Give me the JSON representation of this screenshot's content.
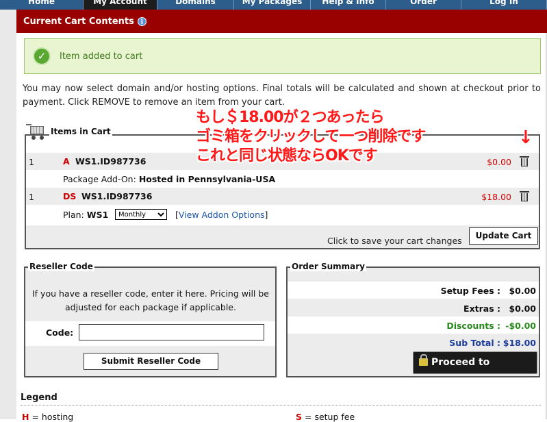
{
  "nav": {
    "tabs": [
      {
        "label": "Home",
        "active": false
      },
      {
        "label": "My Account",
        "active": true
      },
      {
        "label": "Domains",
        "active": false
      },
      {
        "label": "My Packages",
        "active": false
      },
      {
        "label": "Help & Info",
        "active": false
      },
      {
        "label": "Order",
        "active": false
      },
      {
        "label": "Log In",
        "active": false
      }
    ]
  },
  "header": {
    "title": "Current Cart Contents",
    "info_icon": "info-icon"
  },
  "alert": {
    "message": "Item added to cart",
    "icon": "check-circle-icon"
  },
  "intro": "You may now select domain and/or hosting options. Final totals will be calculated and shown at checkout prior to payment. Click REMOVE to remove an item from your cart.",
  "annotation": {
    "lines": [
      "もし＄18.00が２つあったら",
      "ゴミ箱をクリックして一つ削除です",
      "これと同じ状態ならOKです"
    ],
    "arrow": "↓"
  },
  "cart": {
    "legend": "Items in Cart",
    "items": [
      {
        "qty": "1",
        "code": "A",
        "name": "WS1.ID987736",
        "price": "$0.00"
      },
      {
        "qty": "1",
        "code": "DS",
        "name": "WS1.ID987736",
        "price": "$18.00"
      }
    ],
    "addon_label": "Package Add-On:",
    "addon_value": "Hosted in Pennsylvania-USA",
    "plan_label": "Plan:",
    "plan_value": "WS1",
    "plan_select": "Monthly",
    "addon_link_open": "[",
    "addon_link": "View Addon Options",
    "addon_link_close": "]",
    "save_hint": "Click to save your cart changes",
    "update_button": "Update Cart"
  },
  "reseller": {
    "legend": "Reseller Code",
    "text": "If you have a reseller code, enter it here. Pricing will be adjusted for each package if applicable.",
    "code_label": "Code:",
    "code_value": "",
    "submit_button": "Submit Reseller Code"
  },
  "summary": {
    "legend": "Order Summary",
    "rows": [
      {
        "label": "Setup Fees :",
        "value": "$0.00"
      },
      {
        "label": "Extras :",
        "value": "$0.00"
      },
      {
        "label": "Discounts :",
        "value": "-$0.00"
      },
      {
        "label": "Sub Total :",
        "value": "$18.00"
      }
    ],
    "checkout_button": "Proceed to Checkout"
  },
  "legend_section": {
    "title": "Legend",
    "h_key": "H",
    "h_desc": "= hosting",
    "s_key": "S",
    "s_desc": "= setup fee"
  },
  "colors": {
    "nav": "#2d5d8a",
    "header": "#990000",
    "price": "#cc0000",
    "discount": "#2a8a1f",
    "subtotal": "#1d3d9a"
  }
}
